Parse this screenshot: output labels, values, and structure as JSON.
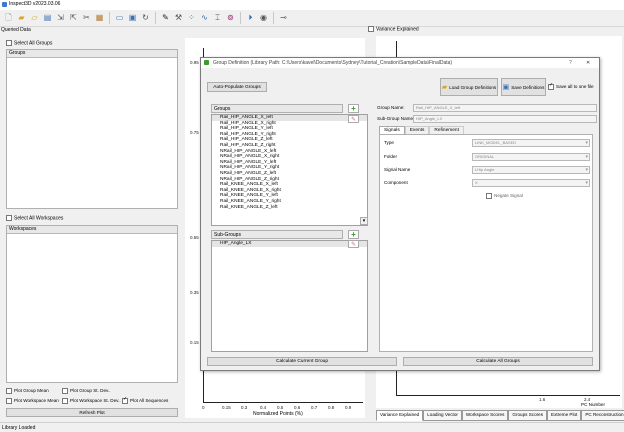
{
  "app": {
    "title": "Inspect3D v2023.03.06"
  },
  "toolbar": {
    "icons": [
      "new-file",
      "open-folder",
      "open-file",
      "save-file",
      "import-file",
      "export-file",
      "cut",
      "paste",
      "monitor",
      "save-disk",
      "refresh",
      "marker",
      "tools",
      "scatter",
      "curve",
      "measure",
      "goggles",
      "play",
      "camera",
      "pin"
    ]
  },
  "left": {
    "queried_data": "Queried Data",
    "select_all_groups": "Select All Groups",
    "groups_header": "Groups",
    "select_all_workspaces": "Select All Workspaces",
    "workspaces_header": "Workspaces",
    "plot_group_mean": "Plot Group Mean",
    "plot_group_std": "Plot Group St. Dev..",
    "plot_workspace_mean": "Plot Workspace Mean",
    "plot_workspace_std": "Plot Workspace St. Dev..",
    "plot_all_sequences": "Plot All Sequences",
    "refresh_plot": "Refresh Plot"
  },
  "middle_plot": {
    "yticks": [
      "0.95",
      "0.75",
      "0.55",
      "0.35",
      "0.15"
    ],
    "xticks": [
      "0",
      "0.15",
      "0.3",
      "0.4",
      "0.5",
      "0.6",
      "0.7",
      "0.8",
      "0.9"
    ],
    "xlabel": "Normalized Points (%)"
  },
  "right_plot": {
    "title": "Variance Explained",
    "xticks": [
      "1.6",
      "2.4"
    ],
    "xlabel": "PC Number",
    "tabs": [
      "Variance Explained",
      "Loading Vector",
      "Workspace Scores",
      "Groups Scores",
      "Extreme Plot",
      "PC Reconstruction"
    ]
  },
  "dialog": {
    "title": "Group Definition (Library Path: C:\\Users\\kavel\\Documents\\Sydney\\Tutorial_Creation\\SampleData\\FinalData)",
    "help": "?",
    "close": "✕",
    "auto_populate": "Auto-Populate Groups",
    "load_defs": "Load Group Definitions",
    "save_defs": "Save Definitions",
    "save_all_one_file": "Save all to one file",
    "groups_header": "Groups",
    "groups": [
      "Rail_HIP_ANGLE_X_left",
      "Rail_HIP_ANGLE_X_right",
      "Rail_HIP_ANGLE_Y_left",
      "Rail_HIP_ANGLE_Y_right",
      "Rail_HIP_ANGLE_Z_left",
      "Rail_HIP_ANGLE_Z_right",
      "NRail_HIP_ANGLE_X_left",
      "NRail_HIP_ANGLE_X_right",
      "NRail_HIP_ANGLE_Y_left",
      "NRail_HIP_ANGLE_Y_right",
      "NRail_HIP_ANGLE_Z_left",
      "NRail_HIP_ANGLE_Z_right",
      "Rail_KNEE_ANGLE_X_left",
      "Rail_KNEE_ANGLE_X_right",
      "Rail_KNEE_ANGLE_Y_left",
      "Rail_KNEE_ANGLE_Y_right",
      "Rail_KNEE_ANGLE_Z_left"
    ],
    "subgroups_header": "Sub-Groups",
    "subgroups": [
      "HIP_Angle_LX"
    ],
    "group_name_label": "Group Name:",
    "group_name_value": "Rail_HIP_ANGLE_X_left",
    "subgroup_name_label": "Sub-Group Name:",
    "subgroup_name_value": "HIP_Angle_LX",
    "tabs": [
      "Signals",
      "Events",
      "Refinement"
    ],
    "type_label": "Type",
    "type_value": "LINK_MODEL_BASED",
    "folder_label": "Folder",
    "folder_value": "ORIGINAL",
    "signal_name_label": "Signal Name",
    "signal_name_value": "LHip Angle",
    "component_label": "Component",
    "component_value": "X",
    "negate_signal": "Negate Signal",
    "calc_current": "Calculate Current Group",
    "calc_all": "Calculate All Groups"
  },
  "status": "Library Loaded"
}
